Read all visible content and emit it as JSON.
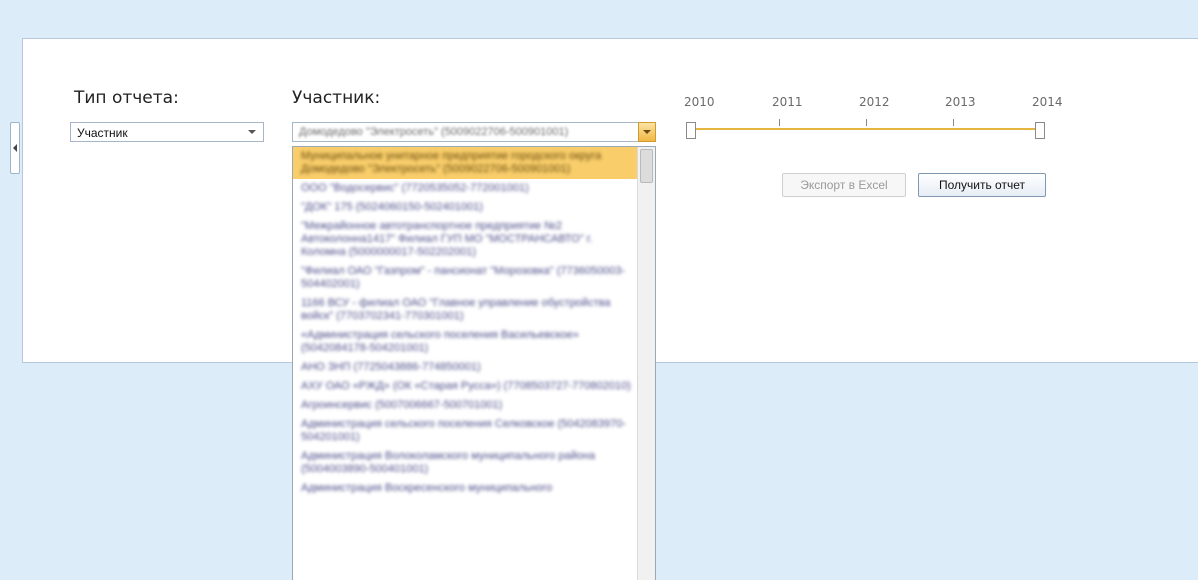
{
  "form": {
    "report_type_label": "Тип отчета:",
    "report_type_value": "Участник",
    "participant_label": "Участник:",
    "participant_value": "Домодедово \"Электросеть\" (5009022706-500901001)"
  },
  "dropdown": {
    "options": [
      "Муниципальное унитарное предприятие городского округа Домодедово \"Электросеть\" (5009022706-500901001)",
      "ООО \"Водосервис\" (7720535052-772001001)",
      "\"ДОК\" 175 (5024060150-502401001)",
      "\"Межрайонное автотранспортное предприятие №2 Автоколонна1417\" Филиал ГУП МО \"МОСТРАНСАВТО\" г. Коломна (5000000017-502202001)",
      "\"Филиал ОАО \"Газпром\" - пансионат \"Морозовка\" (7736050003-504402001)",
      "1166 ВСУ - филиал ОАО \"Главное управление обустройства войск\" (7703702341-770301001)",
      "«Администрация сельского поселения Васильевское» (5042084178-504201001)",
      "АНО ЗНП (7725043886-774850001)",
      "АХУ ОАО «РЖД» (ОК «Старая Русса») (7708503727-770802010)",
      "Агроинсервис (5007006667-500701001)",
      "Администрация сельского поселения Селковское (5042083970-504201001)",
      "Администрация Волоколамского муниципального района (5004003890-500401001)",
      "Администрация Воскресенского муниципального"
    ],
    "selected_index": 0
  },
  "timeline": {
    "years": [
      "2010",
      "2011",
      "2012",
      "2013",
      "2014"
    ],
    "range_start": "2010",
    "range_end": "2014"
  },
  "buttons": {
    "export_label": "Экспорт в Excel",
    "get_report_label": "Получить отчет"
  },
  "colors": {
    "background": "#dcecf9",
    "accent": "#f8cd6a",
    "slider_track": "#e4b53f"
  }
}
